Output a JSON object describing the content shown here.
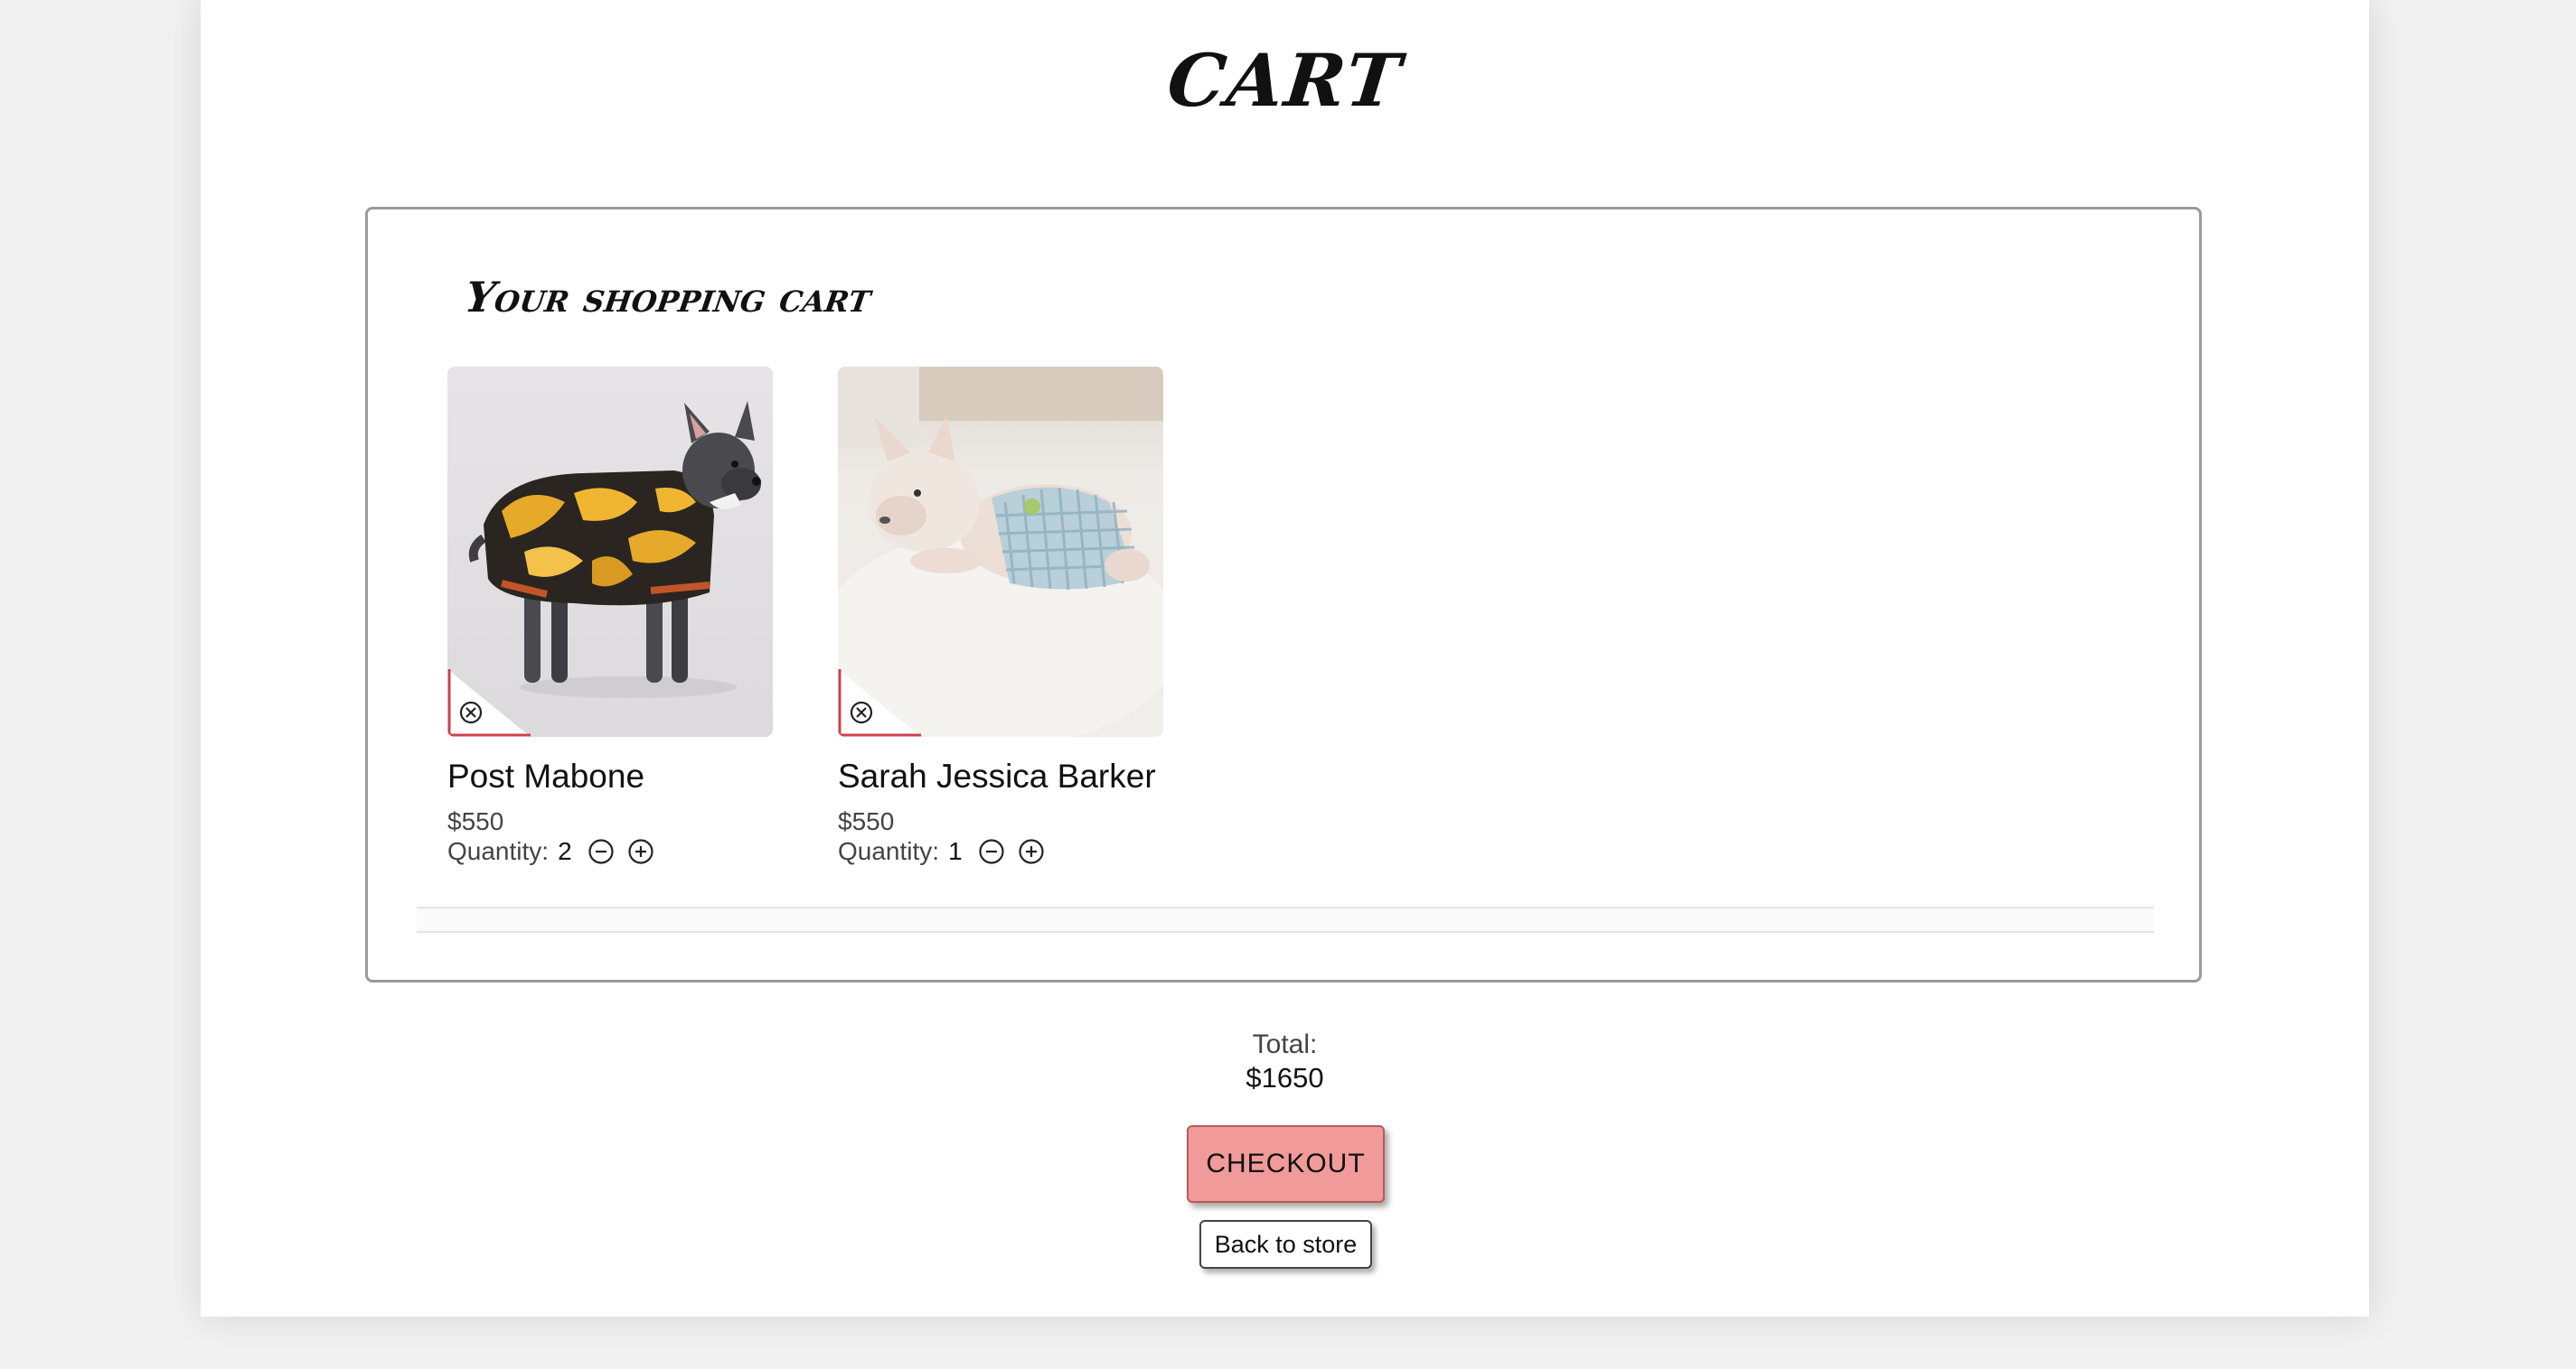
{
  "page": {
    "title": "Cart"
  },
  "cart": {
    "heading": "Your shopping cart",
    "items": [
      {
        "name": "Post Mabone",
        "price": "$550",
        "quantity_label": "Quantity:",
        "quantity": "2",
        "image": "french-bulldog-in-baroque-jacket"
      },
      {
        "name": "Sarah Jessica Barker",
        "price": "$550",
        "quantity_label": "Quantity:",
        "quantity": "1",
        "image": "french-bulldog-in-gingham-dress"
      }
    ]
  },
  "summary": {
    "total_label": "Total:",
    "total_value": "$1650"
  },
  "actions": {
    "checkout_label": "CHECKOUT",
    "back_label": "Back to store"
  },
  "icons": {
    "remove": "close-circle-icon",
    "decrease": "minus-circle-icon",
    "increase": "plus-circle-icon"
  },
  "colors": {
    "checkout_bg": "#f19a9a",
    "remove_accent": "#d0404a",
    "page_bg": "#f1f1f1"
  }
}
